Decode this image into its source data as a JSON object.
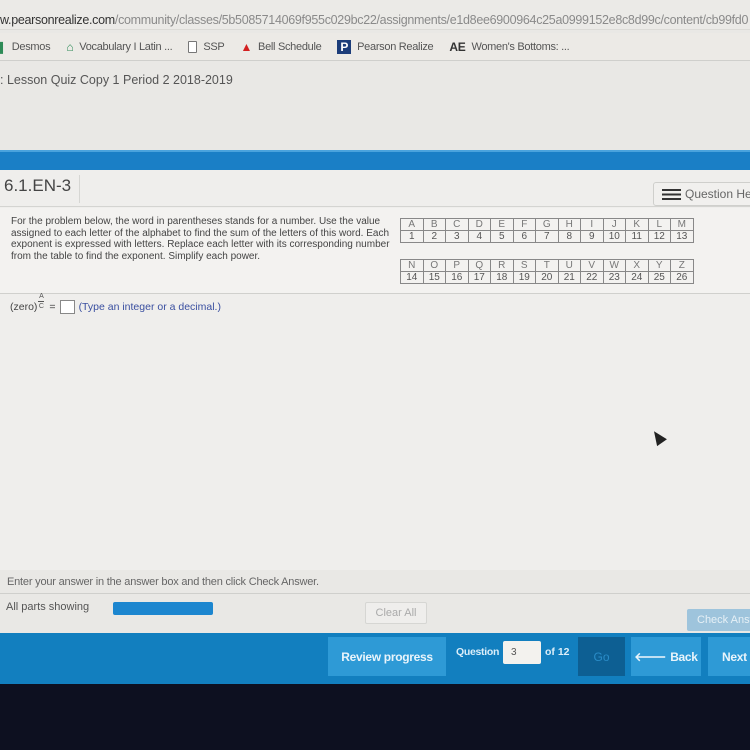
{
  "browser": {
    "url_host": "w.pearsonrealize.com",
    "url_path": "/community/classes/5b5085714069f955c029bc22/assignments/e1d8ee6900964c25a0999152e8c8d99c/content/cb99fd0",
    "bookmarks": [
      {
        "label": "Desmos",
        "icon": "desmos-icon"
      },
      {
        "label": "Vocabulary I Latin ...",
        "icon": "house-icon"
      },
      {
        "label": "SSP",
        "icon": "document-icon"
      },
      {
        "label": "Bell Schedule",
        "icon": "school-icon"
      },
      {
        "label": "Pearson Realize",
        "icon": "pearson-p-icon",
        "glyph": "P"
      },
      {
        "label": "Women's Bottoms: ...",
        "icon": "ae-icon",
        "glyph": "AE"
      }
    ]
  },
  "page": {
    "lesson_title": ": Lesson Quiz Copy 1 Period 2 2018-2019"
  },
  "question": {
    "id": "6.1.EN-3",
    "help_label": "Question Help",
    "instructions": "For the problem below, the word in parentheses stands for a number. Use the value assigned to each letter of the alphabet to find the sum of the letters of this word. Each exponent is expressed with letters. Replace each letter with its corresponding number from the table to find the exponent. Simplify each power.",
    "letter_table_1": {
      "letters": [
        "A",
        "B",
        "C",
        "D",
        "E",
        "F",
        "G",
        "H",
        "I",
        "J",
        "K",
        "L",
        "M"
      ],
      "values": [
        "1",
        "2",
        "3",
        "4",
        "5",
        "6",
        "7",
        "8",
        "9",
        "10",
        "11",
        "12",
        "13"
      ]
    },
    "letter_table_2": {
      "letters": [
        "N",
        "O",
        "P",
        "Q",
        "R",
        "S",
        "T",
        "U",
        "V",
        "W",
        "X",
        "Y",
        "Z"
      ],
      "values": [
        "14",
        "15",
        "16",
        "17",
        "18",
        "19",
        "20",
        "21",
        "22",
        "23",
        "24",
        "25",
        "26"
      ]
    },
    "expression_base": "(zero)",
    "exponent_numerator": "A",
    "exponent_denominator": "C",
    "equals": "=",
    "answer_value": "",
    "answer_hint": "(Type an integer or a decimal.)"
  },
  "footer": {
    "note": "Enter your answer in the answer box and then click Check Answer.",
    "parts_label": "All parts showing",
    "clear_all": "Clear All",
    "check_answer": "Check Answer"
  },
  "nav": {
    "review_progress": "Review progress",
    "question_label": "Question",
    "question_number": "3",
    "of_label": "of 12",
    "go": "Go",
    "back": "Back",
    "back_arrow": "🡐",
    "next": "Next"
  }
}
